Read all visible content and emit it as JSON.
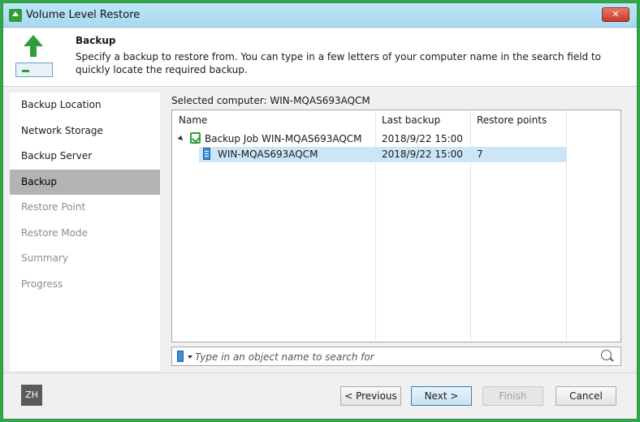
{
  "window": {
    "title": "Volume Level Restore",
    "close_label": "✕"
  },
  "header": {
    "title": "Backup",
    "description": "Specify a backup to restore from. You can type in a few letters of your computer name in the search field to quickly locate the required backup."
  },
  "sidebar": {
    "items": [
      {
        "label": "Backup Location",
        "state": "enabled"
      },
      {
        "label": "Network Storage",
        "state": "enabled"
      },
      {
        "label": "Backup Server",
        "state": "enabled"
      },
      {
        "label": "Backup",
        "state": "active"
      },
      {
        "label": "Restore Point",
        "state": "disabled"
      },
      {
        "label": "Restore Mode",
        "state": "disabled"
      },
      {
        "label": "Summary",
        "state": "disabled"
      },
      {
        "label": "Progress",
        "state": "disabled"
      }
    ]
  },
  "main": {
    "selected_computer": "Selected computer: WIN-MQAS693AQCM",
    "columns": [
      "Name",
      "Last backup",
      "Restore points"
    ],
    "rows": [
      {
        "name": "Backup Job WIN-MQAS693AQCM",
        "last_backup": "2018/9/22 15:00",
        "restore_points": ""
      },
      {
        "name": "WIN-MQAS693AQCM",
        "last_backup": "2018/9/22 15:00",
        "restore_points": "7"
      }
    ],
    "search_placeholder": "Type in an object name to search for"
  },
  "footer": {
    "language": "ZH",
    "previous_label": "< Previous",
    "next_label": "Next >",
    "finish_label": "Finish",
    "cancel_label": "Cancel"
  },
  "colors": {
    "accent_green": "#2e9d3a",
    "selection_blue": "#cce6f7",
    "active_nav": "#b3b3b3"
  }
}
